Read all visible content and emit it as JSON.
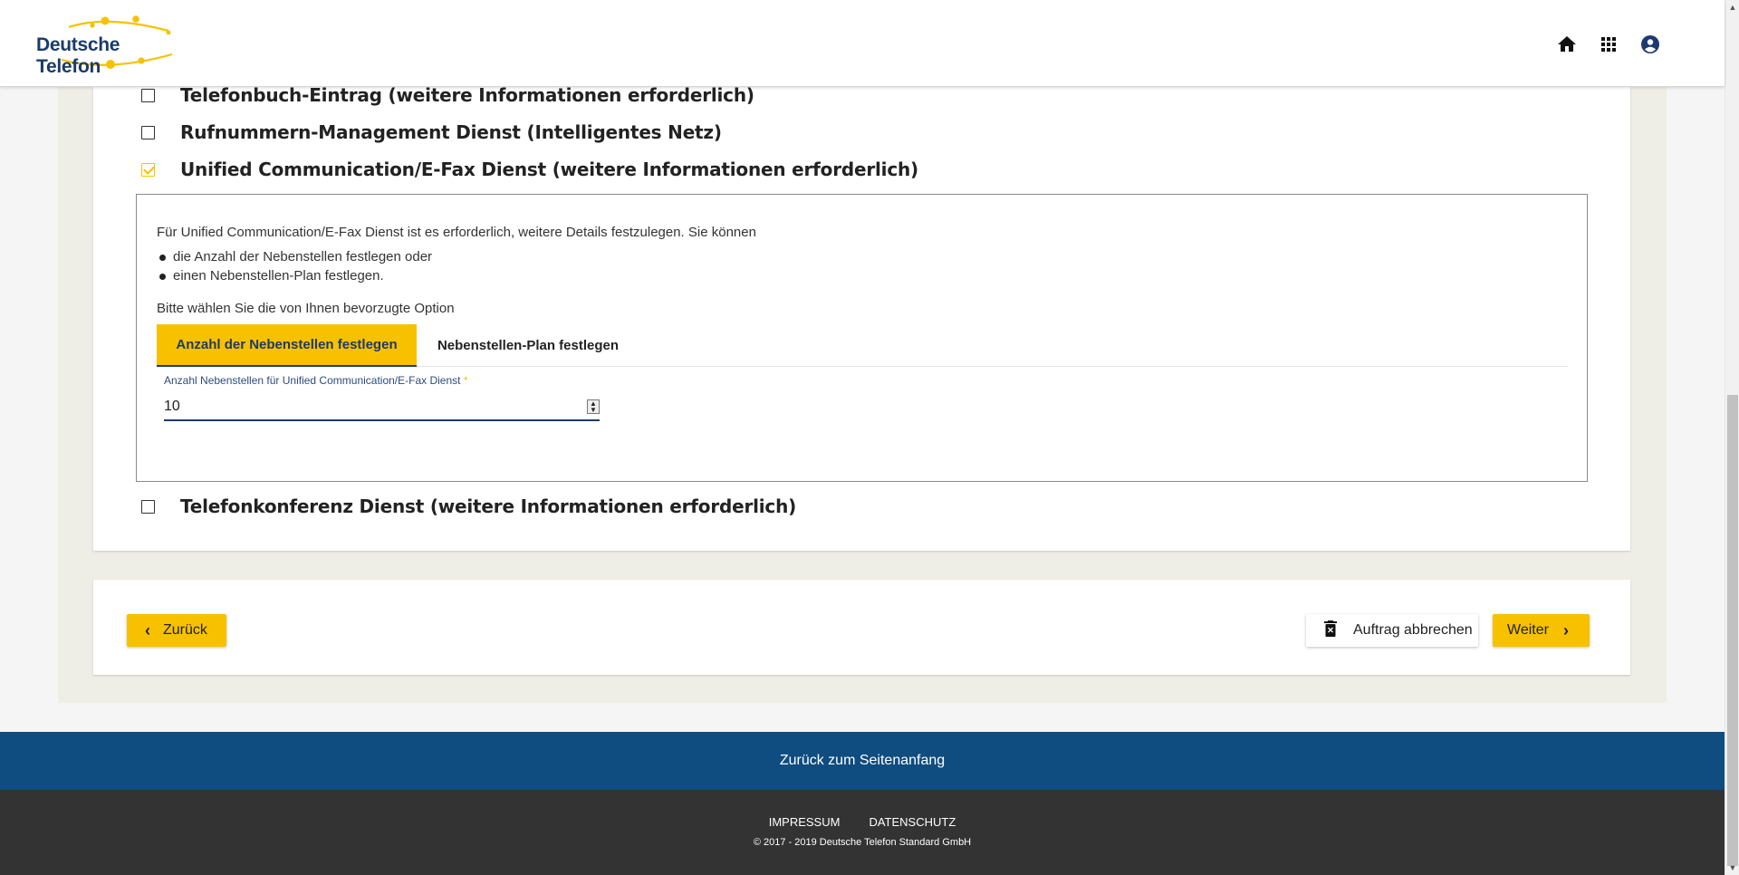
{
  "header": {
    "logo_text": "Deutsche Telefon",
    "icons": [
      "home-icon",
      "apps-grid-icon",
      "account-icon"
    ]
  },
  "services": [
    {
      "label": "Telefonbuch-Eintrag (weitere Informationen erforderlich)",
      "checked": false
    },
    {
      "label": "Rufnummern-Management Dienst (Intelligentes Netz)",
      "checked": false
    },
    {
      "label": "Unified Communication/E-Fax Dienst (weitere Informationen erforderlich)",
      "checked": true
    },
    {
      "label": "Telefonkonferenz Dienst (weitere Informationen erforderlich)",
      "checked": false
    }
  ],
  "option_panel": {
    "intro": "Für Unified Communication/E-Fax Dienst ist es erforderlich, weitere Details festzulegen. Sie können",
    "bullets": [
      "die Anzahl der Nebenstellen festlegen oder",
      "einen Nebenstellen-Plan festlegen."
    ],
    "prompt": "Bitte wählen Sie die von Ihnen bevorzugte Option",
    "tabs": [
      {
        "label": "Anzahl der Nebenstellen festlegen",
        "active": true
      },
      {
        "label": "Nebenstellen-Plan festlegen",
        "active": false
      }
    ],
    "field": {
      "label": "Anzahl Nebenstellen für Unified Communication/E-Fax Dienst",
      "required_mark": "*",
      "value": "10"
    }
  },
  "actions": {
    "back": "Zurück",
    "cancel": "Auftrag abbrechen",
    "next": "Weiter"
  },
  "footer": {
    "back_to_top": "Zurück zum Seitenanfang",
    "links": [
      "IMPRESSUM",
      "DATENSCHUTZ"
    ],
    "copyright": "© 2017 - 2019  Deutsche Telefon Standard GmbH"
  },
  "colors": {
    "accent": "#f7c100",
    "brand_blue": "#1d3a6d",
    "footer_blue": "#0f4c7f",
    "footer_dark": "#333333"
  }
}
